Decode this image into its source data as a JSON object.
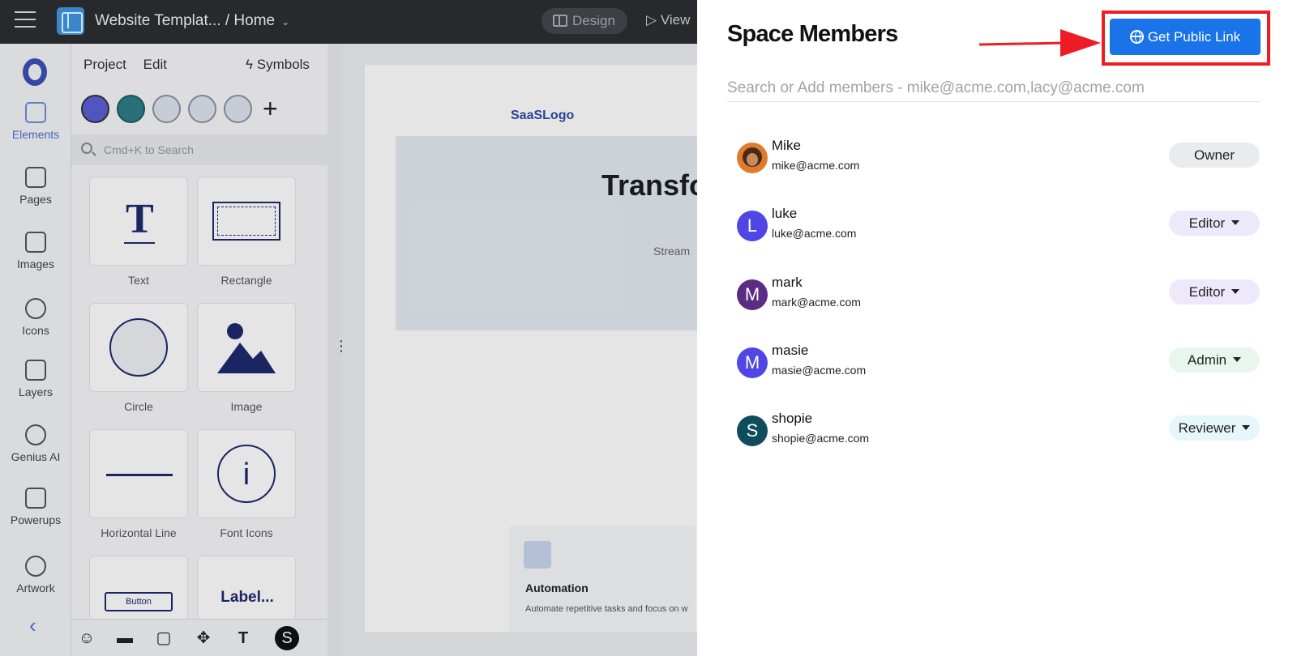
{
  "editor": {
    "breadcrumb": "Website Templat... / Home",
    "design_label": "Design",
    "view_label": "View",
    "menu": [
      "Project",
      "Edit"
    ],
    "symbols_label": "Symbols",
    "search_placeholder": "Cmd+K to Search",
    "rail": [
      "Elements",
      "Pages",
      "Images",
      "Icons",
      "Layers",
      "Genius AI",
      "Powerups",
      "Artwork"
    ],
    "tiles": [
      "Text",
      "Rectangle",
      "Circle",
      "Image",
      "Horizontal Line",
      "Font Icons"
    ],
    "tile_button_text": "Button",
    "tile_label_text": "Label...",
    "canvas": {
      "logo": "SaaSLogo",
      "hero_title": "Transfo",
      "hero_sub": "Stream",
      "feature_title": "Automation",
      "feature_text": "Automate repetitive tasks and focus on w"
    }
  },
  "members": {
    "title": "Space Members",
    "public_link_label": "Get Public Link",
    "search_placeholder": "Search or Add members - mike@acme.com,lacy@acme.com",
    "list": [
      {
        "name": "Mike",
        "email": "mike@acme.com",
        "initial": "",
        "role": "Owner",
        "dropdown": false,
        "avatar_color": "#e07a2c",
        "role_bg": "#e9ecef"
      },
      {
        "name": "luke",
        "email": "luke@acme.com",
        "initial": "L",
        "role": "Editor",
        "dropdown": true,
        "avatar_color": "#4f46e5",
        "role_bg": "#ede9fb"
      },
      {
        "name": "mark",
        "email": "mark@acme.com",
        "initial": "M",
        "role": "Editor",
        "dropdown": true,
        "avatar_color": "#5b2c83",
        "role_bg": "#ede9fb"
      },
      {
        "name": "masie",
        "email": "masie@acme.com",
        "initial": "M",
        "role": "Admin",
        "dropdown": true,
        "avatar_color": "#4f46e5",
        "role_bg": "#e8f7ee"
      },
      {
        "name": "shopie",
        "email": "shopie@acme.com",
        "initial": "S",
        "role": "Reviewer",
        "dropdown": true,
        "avatar_color": "#0f4c5c",
        "role_bg": "#e6f6fb"
      }
    ]
  }
}
